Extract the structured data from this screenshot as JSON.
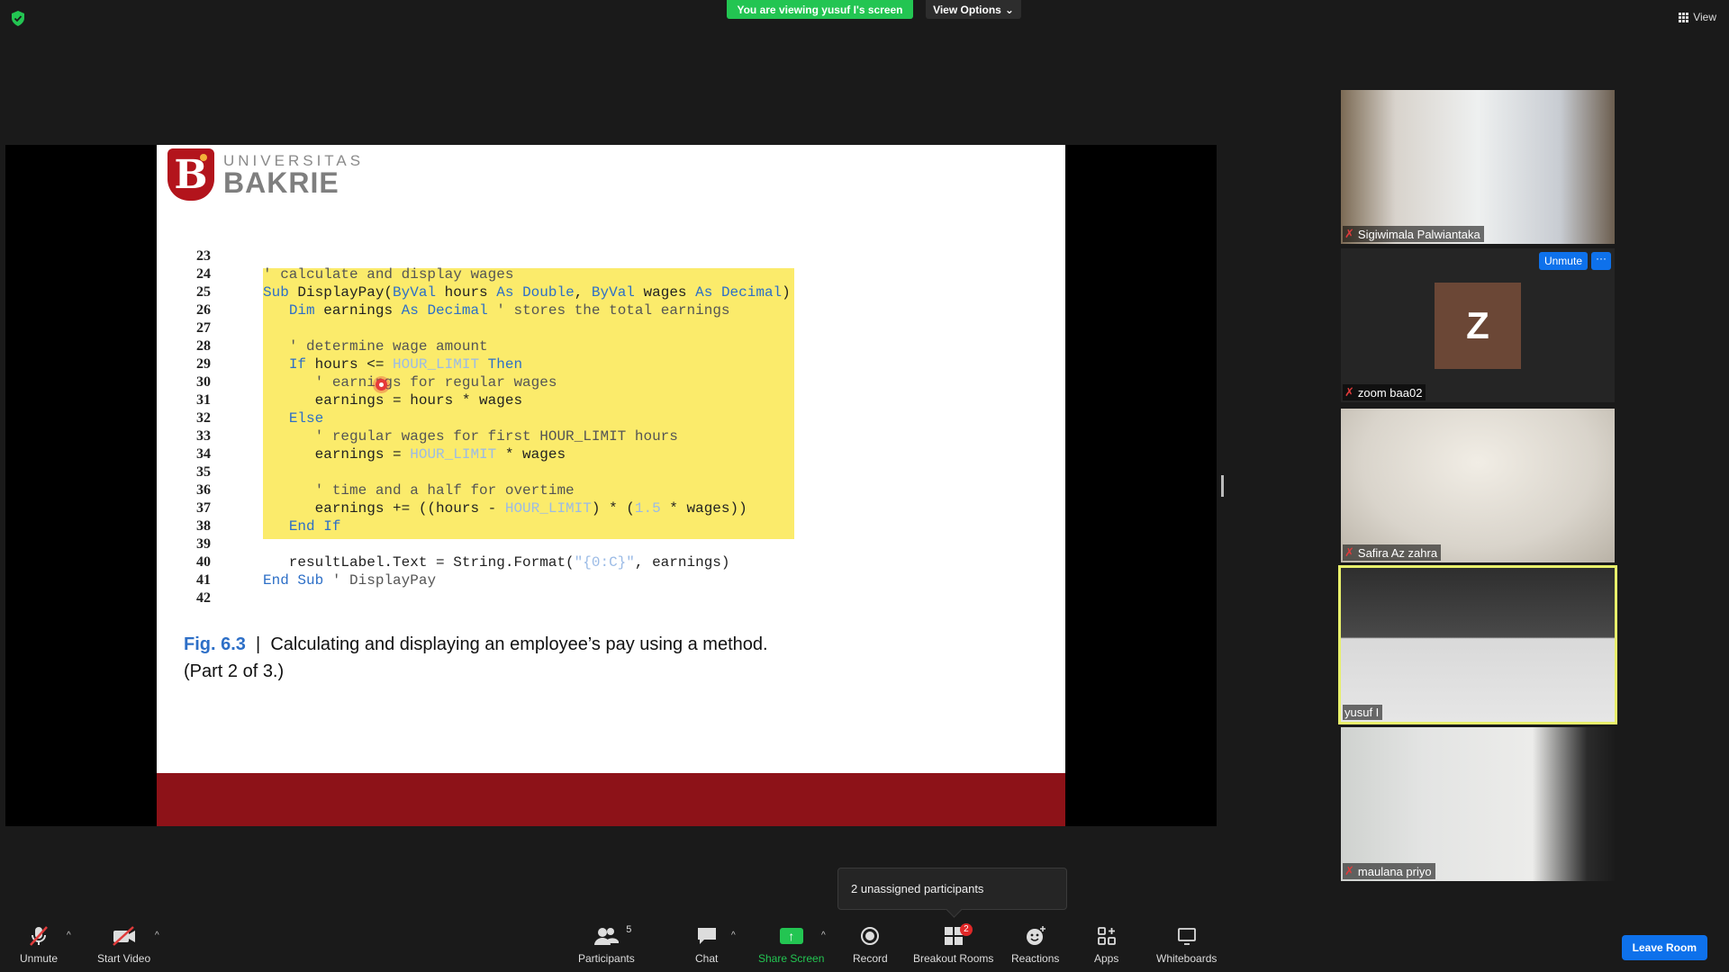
{
  "top": {
    "viewing_banner": "You are viewing yusuf I's screen",
    "view_options_label": "View Options",
    "view_label": "View"
  },
  "slide": {
    "logo": {
      "top": "UNIVERSITAS",
      "bottom": "BAKRIE"
    },
    "line_numbers": [
      "23",
      "24",
      "25",
      "26",
      "27",
      "28",
      "29",
      "30",
      "31",
      "32",
      "33",
      "34",
      "35",
      "36",
      "37",
      "38",
      "39",
      "40",
      "41",
      "42"
    ],
    "code": [
      "' calculate and display wages",
      "Sub DisplayPay(ByVal hours As Double, ByVal wages As Decimal)",
      "   Dim earnings As Decimal ' stores the total earnings",
      "",
      "   ' determine wage amount",
      "   If hours <= HOUR_LIMIT Then",
      "      ' earnings for regular wages",
      "      earnings = hours * wages",
      "   Else",
      "      ' regular wages for first HOUR_LIMIT hours",
      "      earnings = HOUR_LIMIT * wages",
      "",
      "      ' time and a half for overtime",
      "      earnings += ((hours - HOUR_LIMIT) * (1.5 * wages))",
      "   End If",
      "",
      "   resultLabel.Text = String.Format(\"{0:C}\", earnings)",
      "End Sub ' DisplayPay"
    ],
    "caption_fig": "Fig. 6.3",
    "caption_sep": "|",
    "caption_text": "Calculating and displaying an employee’s pay using a method. (Part 2 of 3.)"
  },
  "participants_panel": [
    {
      "name": "Sigiwimala Palwiantaka",
      "muted": true
    },
    {
      "name": "zoom baa02",
      "muted": true,
      "avatar_letter": "Z",
      "unmute_label": "Unmute",
      "more_label": "···"
    },
    {
      "name": "Safira Az zahra",
      "muted": true
    },
    {
      "name": "yusuf I",
      "muted": false,
      "active_speaker": true
    },
    {
      "name": "maulana priyo",
      "muted": true
    }
  ],
  "toast": {
    "text": "2 unassigned participants"
  },
  "toolbar": {
    "unmute": "Unmute",
    "start_video": "Start Video",
    "participants": "Participants",
    "participants_count": "5",
    "chat": "Chat",
    "share_screen": "Share Screen",
    "record": "Record",
    "breakout_rooms": "Breakout Rooms",
    "breakout_badge": "2",
    "reactions": "Reactions",
    "apps": "Apps",
    "whiteboards": "Whiteboards",
    "leave_room": "Leave Room"
  },
  "colors": {
    "share_green": "#23c552",
    "zoom_blue": "#0e71eb",
    "highlight_yellow": "#fbeb6b",
    "slide_footer_red": "#8d1218",
    "keyword_blue": "#2d6fc7"
  }
}
